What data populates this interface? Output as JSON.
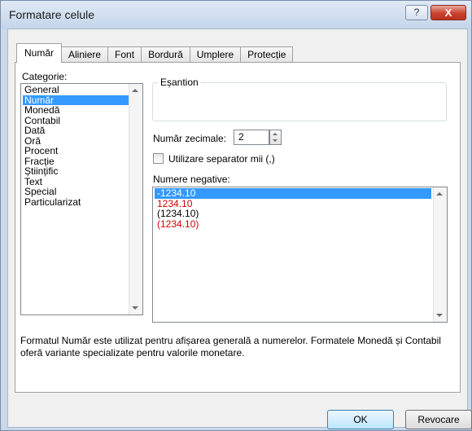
{
  "window": {
    "title": "Formatare celule",
    "help_label": "?",
    "close_label": "X"
  },
  "tabs": [
    {
      "label": "Număr",
      "active": true
    },
    {
      "label": "Aliniere"
    },
    {
      "label": "Font"
    },
    {
      "label": "Bordură"
    },
    {
      "label": "Umplere"
    },
    {
      "label": "Protecție"
    }
  ],
  "category": {
    "label": "Categorie:",
    "items": [
      "General",
      "Număr",
      "Monedă",
      "Contabil",
      "Dată",
      "Oră",
      "Procent",
      "Fracție",
      "Științific",
      "Text",
      "Special",
      "Particularizat"
    ],
    "selected": "Număr"
  },
  "sample": {
    "label": "Eșantion",
    "value": ""
  },
  "decimals": {
    "label": "Număr zecimale:",
    "value": "2"
  },
  "separator": {
    "label": "Utilizare separator mii (,)",
    "checked": false
  },
  "negative_numbers": {
    "label": "Numere negative:",
    "items": [
      {
        "text": "-1234.10",
        "selected": true
      },
      {
        "text": "1234.10",
        "red": true
      },
      {
        "text": "(1234.10)"
      },
      {
        "text": "(1234.10)",
        "red": true
      }
    ]
  },
  "description": "Formatul Număr este utilizat pentru afișarea generală a numerelor. Formatele Monedă și Contabil oferă variante specializate pentru valorile monetare.",
  "buttons": {
    "ok": "OK",
    "cancel": "Revocare"
  },
  "colors": {
    "selection": "#3399ff",
    "negative_red": "#d00000"
  }
}
